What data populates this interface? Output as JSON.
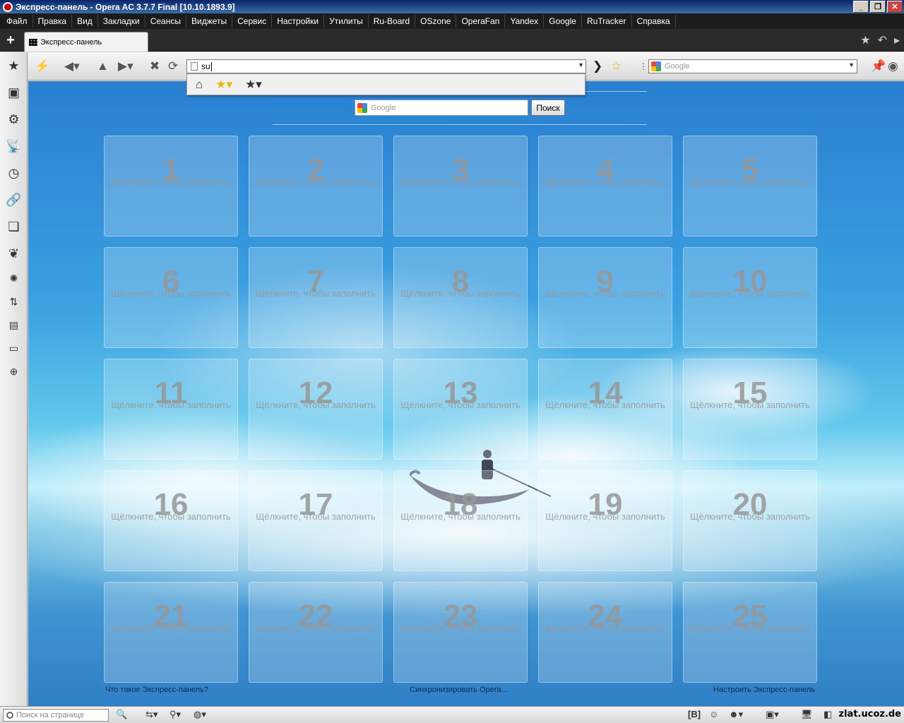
{
  "window": {
    "title": "Экспресс-панель - Opera AC 3.7.7 Final [10.10.1893.9]"
  },
  "menu": [
    "Файл",
    "Правка",
    "Вид",
    "Закладки",
    "Сеансы",
    "Виджеты",
    "Сервис",
    "Настройки",
    "Утилиты",
    "Ru-Board",
    "OSzone",
    "OperaFan",
    "Yandex",
    "Google",
    "RuTracker",
    "Справка"
  ],
  "tab": {
    "label": "Экспресс-панель"
  },
  "address": {
    "value": "su"
  },
  "search_engine": {
    "placeholder": "Google"
  },
  "page_search": {
    "placeholder": "Google",
    "button": "Поиск"
  },
  "tiles": [
    {
      "num": "1",
      "text": "Щёлкните, чтобы заполнить"
    },
    {
      "num": "2",
      "text": "Щёлкните, чтобы заполнить"
    },
    {
      "num": "3",
      "text": "Щёлкните, чтобы заполнить"
    },
    {
      "num": "4",
      "text": "Щёлкните, чтобы заполнить"
    },
    {
      "num": "5",
      "text": "Щёлкните, чтобы заполнить"
    },
    {
      "num": "6",
      "text": "Щёлкните, чтобы заполнить"
    },
    {
      "num": "7",
      "text": "Щёлкните, чтобы заполнить"
    },
    {
      "num": "8",
      "text": "Щёлкните, чтобы заполнить"
    },
    {
      "num": "9",
      "text": "Щёлкните, чтобы заполнить"
    },
    {
      "num": "10",
      "text": "Щёлкните, чтобы заполнить"
    },
    {
      "num": "11",
      "text": "Щёлкните, чтобы заполнить"
    },
    {
      "num": "12",
      "text": "Щёлкните, чтобы заполнить"
    },
    {
      "num": "13",
      "text": "Щёлкните, чтобы заполнить"
    },
    {
      "num": "14",
      "text": "Щёлкните, чтобы заполнить"
    },
    {
      "num": "15",
      "text": "Щёлкните, чтобы заполнить"
    },
    {
      "num": "16",
      "text": "Щёлкните, чтобы заполнить"
    },
    {
      "num": "17",
      "text": "Щёлкните, чтобы заполнить"
    },
    {
      "num": "18",
      "text": "Щёлкните, чтобы заполнить"
    },
    {
      "num": "19",
      "text": "Щёлкните, чтобы заполнить"
    },
    {
      "num": "20",
      "text": "Щёлкните, чтобы заполнить"
    },
    {
      "num": "21",
      "text": "Щёлкните, чтобы заполнить"
    },
    {
      "num": "22",
      "text": "Щёлкните, чтобы заполнить"
    },
    {
      "num": "23",
      "text": "Щёлкните, чтобы заполнить"
    },
    {
      "num": "24",
      "text": "Щёлкните, чтобы заполнить"
    },
    {
      "num": "25",
      "text": "Щёлкните, чтобы заполнить"
    }
  ],
  "footer": {
    "left": "Что такое Экспресс-панель?",
    "center": "Синхронизировать Opera...",
    "right": "Настроить Экспресс-панель"
  },
  "status": {
    "find_placeholder": "Поиск на странице",
    "bracket_label": "[B]",
    "watermark": "zlat.ucoz.de"
  },
  "sidebar_icons": [
    "star-icon",
    "windows-icon",
    "gear-icon",
    "satellite-icon",
    "clock-icon",
    "link-icon",
    "pages-icon",
    "unite-icon",
    "widgets-icon",
    "transfer-icon",
    "notes-icon",
    "panel-icon",
    "add-icon"
  ]
}
